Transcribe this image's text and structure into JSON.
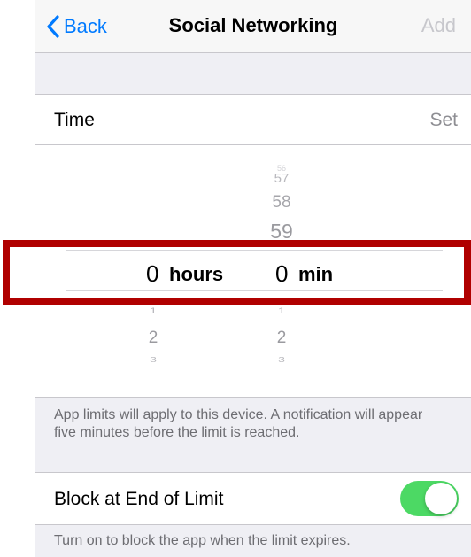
{
  "nav": {
    "back_label": "Back",
    "title": "Social Networking",
    "add_label": "Add"
  },
  "time_row": {
    "label": "Time",
    "value": "Set"
  },
  "picker": {
    "hours": {
      "selected": "0",
      "unit": "hours",
      "below": [
        "1",
        "2",
        "3"
      ]
    },
    "minutes": {
      "selected": "0",
      "unit": "min",
      "above": [
        "56",
        "57",
        "58",
        "59"
      ],
      "below": [
        "1",
        "2",
        "3"
      ]
    }
  },
  "info_text": "App limits will apply to this device. A notification will appear five minutes before the limit is reached.",
  "block_row": {
    "label": "Block at End of Limit",
    "toggle_on": true
  },
  "block_footer": "Turn on to block the app when the limit expires.",
  "colors": {
    "accent": "#007aff",
    "toggle_on": "#4cd964",
    "highlight": "#b00000"
  }
}
